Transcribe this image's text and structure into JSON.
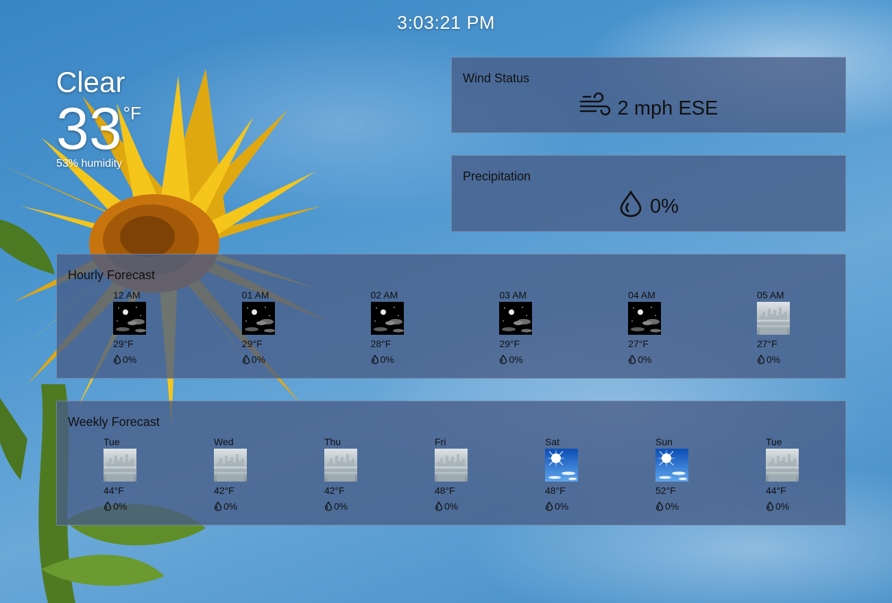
{
  "clock": "3:03:21 PM",
  "current": {
    "condition": "Clear",
    "temperature": "33",
    "unit": "°F",
    "humidity": "53% humidity"
  },
  "wind": {
    "title": "Wind Status",
    "value": "2 mph ESE",
    "icon": "wind-icon"
  },
  "precipitation": {
    "title": "Precipitation",
    "value": "0%",
    "icon": "raindrop-icon"
  },
  "hourly": {
    "title": "Hourly Forecast",
    "items": [
      {
        "label": "12 AM",
        "icon": "night-clear-icon",
        "temp": "29°F",
        "pop": "0%"
      },
      {
        "label": "01 AM",
        "icon": "night-clear-icon",
        "temp": "29°F",
        "pop": "0%"
      },
      {
        "label": "02 AM",
        "icon": "night-clear-icon",
        "temp": "28°F",
        "pop": "0%"
      },
      {
        "label": "03 AM",
        "icon": "night-clear-icon",
        "temp": "29°F",
        "pop": "0%"
      },
      {
        "label": "04 AM",
        "icon": "night-clear-icon",
        "temp": "27°F",
        "pop": "0%"
      },
      {
        "label": "05 AM",
        "icon": "fog-icon",
        "temp": "27°F",
        "pop": "0%"
      }
    ]
  },
  "weekly": {
    "title": "Weekly Forecast",
    "items": [
      {
        "label": "Tue",
        "icon": "fog-icon",
        "temp": "44°F",
        "pop": "0%"
      },
      {
        "label": "Wed",
        "icon": "fog-icon",
        "temp": "42°F",
        "pop": "0%"
      },
      {
        "label": "Thu",
        "icon": "fog-icon",
        "temp": "42°F",
        "pop": "0%"
      },
      {
        "label": "Fri",
        "icon": "fog-icon",
        "temp": "48°F",
        "pop": "0%"
      },
      {
        "label": "Sat",
        "icon": "sunny-icon",
        "temp": "48°F",
        "pop": "0%"
      },
      {
        "label": "Sun",
        "icon": "sunny-icon",
        "temp": "52°F",
        "pop": "0%"
      },
      {
        "label": "Tue",
        "icon": "fog-icon",
        "temp": "44°F",
        "pop": "0%"
      }
    ]
  },
  "colors": {
    "panel": "#485c87",
    "sky": "#3a86c4",
    "petal": "#f2c21a",
    "seed": "#b86a0c"
  }
}
